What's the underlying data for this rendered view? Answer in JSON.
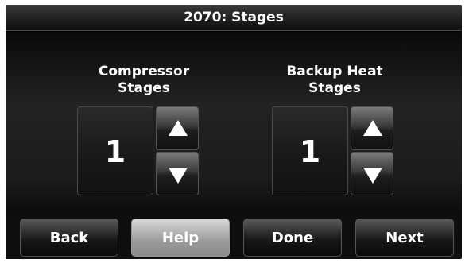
{
  "header": {
    "title": "2070: Stages"
  },
  "compressor": {
    "label_line1": "Compressor",
    "label_line2": "Stages",
    "value": "1"
  },
  "backup_heat": {
    "label_line1": "Backup Heat",
    "label_line2": "Stages",
    "value": "1"
  },
  "nav": {
    "back": "Back",
    "help": "Help",
    "done": "Done",
    "next": "Next"
  },
  "icons": {
    "up": "up-arrow-icon",
    "down": "down-arrow-icon"
  },
  "colors": {
    "background": "#000000",
    "help_button": "#b0b0b0",
    "text": "#ffffff"
  }
}
